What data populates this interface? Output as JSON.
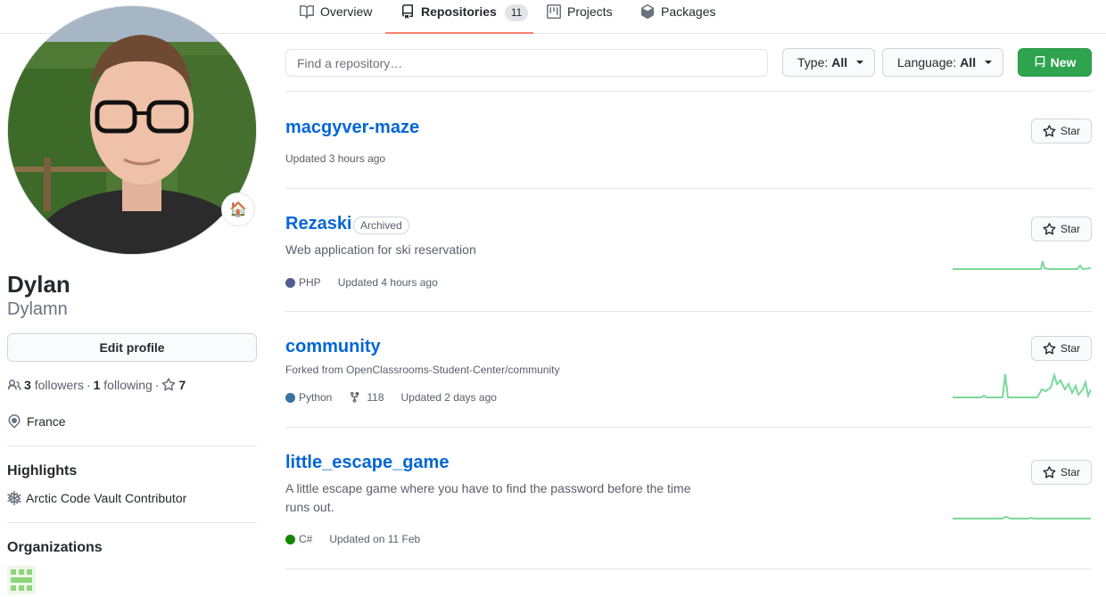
{
  "tabs": [
    {
      "label": "Overview",
      "icon": "book-icon"
    },
    {
      "label": "Repositories",
      "icon": "repo-icon",
      "count": "11"
    },
    {
      "label": "Projects",
      "icon": "project-icon"
    },
    {
      "label": "Packages",
      "icon": "package-icon"
    }
  ],
  "profile": {
    "name": "Dylan",
    "login": "Dylamn",
    "edit_label": "Edit profile",
    "followers_count": "3",
    "followers_label": "followers",
    "following_count": "1",
    "following_label": "following",
    "stars_count": "7",
    "location": "France",
    "status_emoji": "🏠"
  },
  "highlights": {
    "title": "Highlights",
    "items": [
      "Arctic Code Vault Contributor"
    ]
  },
  "organizations": {
    "title": "Organizations"
  },
  "search": {
    "placeholder": "Find a repository…"
  },
  "filters": {
    "type_label": "Type:",
    "type_value": "All",
    "language_label": "Language:",
    "language_value": "All",
    "new_label": "New"
  },
  "star_label": "Star",
  "repos": [
    {
      "name": "macgyver-maze",
      "updated": "Updated 3 hours ago"
    },
    {
      "name": "Rezaski",
      "badge": "Archived",
      "description": "Web application for ski reservation",
      "language": "PHP",
      "language_color": "#4F5D95",
      "updated": "Updated 4 hours ago"
    },
    {
      "name": "community",
      "forked_from": "Forked from OpenClassrooms-Student-Center/community",
      "language": "Python",
      "language_color": "#3572A5",
      "forks": "118",
      "updated": "Updated 2 days ago"
    },
    {
      "name": "little_escape_game",
      "description": "A little escape game where you have to find the password before the time runs out.",
      "language": "C#",
      "language_color": "#178600",
      "updated": "Updated on 11 Feb"
    }
  ],
  "colors": {
    "accent_green": "#2ea44f",
    "link_blue": "#0366d6",
    "tab_underline": "#f9826c",
    "sparkline": "#7ad99a"
  }
}
